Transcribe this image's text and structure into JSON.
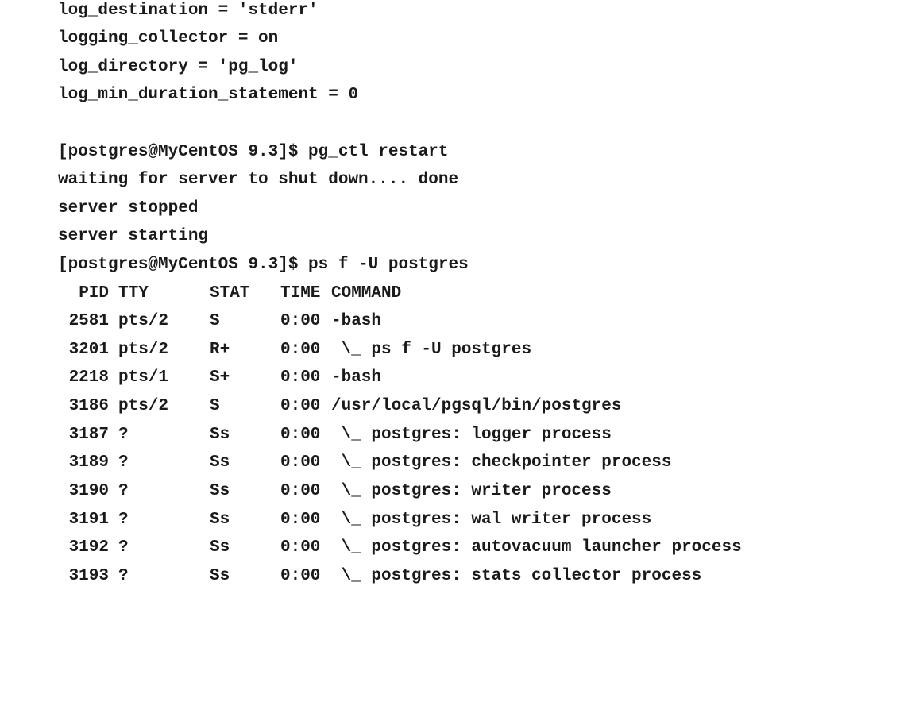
{
  "config_lines": [
    "log_destination = 'stderr'",
    "logging_collector = on",
    "log_directory = 'pg_log'",
    "log_min_duration_statement = 0"
  ],
  "session_lines": [
    "[postgres@MyCentOS 9.3]$ pg_ctl restart",
    "waiting for server to shut down.... done",
    "server stopped",
    "server starting",
    "[postgres@MyCentOS 9.3]$ ps f -U postgres"
  ],
  "ps_table": {
    "headers": {
      "pid": "PID",
      "tty": "TTY",
      "stat": "STAT",
      "time": "TIME",
      "command": "COMMAND"
    },
    "rows": [
      {
        "pid": "2581",
        "tty": "pts/2",
        "stat": "S",
        "time": "0:00",
        "command": "-bash"
      },
      {
        "pid": "3201",
        "tty": "pts/2",
        "stat": "R+",
        "time": "0:00",
        "command": " \\_ ps f -U postgres"
      },
      {
        "pid": "2218",
        "tty": "pts/1",
        "stat": "S+",
        "time": "0:00",
        "command": "-bash"
      },
      {
        "pid": "3186",
        "tty": "pts/2",
        "stat": "S",
        "time": "0:00",
        "command": "/usr/local/pgsql/bin/postgres"
      },
      {
        "pid": "3187",
        "tty": "?",
        "stat": "Ss",
        "time": "0:00",
        "command": " \\_ postgres: logger process"
      },
      {
        "pid": "3189",
        "tty": "?",
        "stat": "Ss",
        "time": "0:00",
        "command": " \\_ postgres: checkpointer process"
      },
      {
        "pid": "3190",
        "tty": "?",
        "stat": "Ss",
        "time": "0:00",
        "command": " \\_ postgres: writer process"
      },
      {
        "pid": "3191",
        "tty": "?",
        "stat": "Ss",
        "time": "0:00",
        "command": " \\_ postgres: wal writer process"
      },
      {
        "pid": "3192",
        "tty": "?",
        "stat": "Ss",
        "time": "0:00",
        "command": " \\_ postgres: autovacuum launcher process"
      },
      {
        "pid": "3193",
        "tty": "?",
        "stat": "Ss",
        "time": "0:00",
        "command": " \\_ postgres: stats collector process"
      }
    ]
  }
}
